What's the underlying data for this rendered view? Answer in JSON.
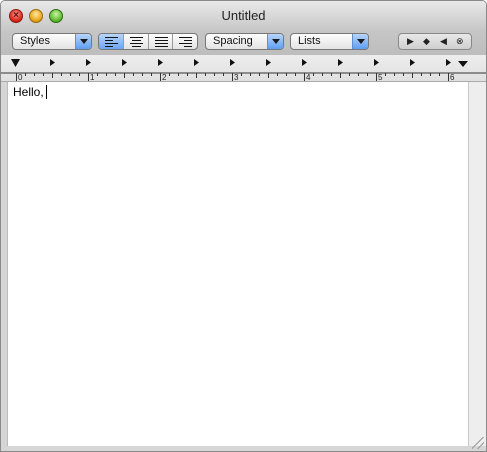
{
  "window": {
    "title": "Untitled"
  },
  "toolbar": {
    "styles_label": "Styles",
    "spacing_label": "Spacing",
    "lists_label": "Lists",
    "alignment": {
      "options": [
        "align-left",
        "align-center",
        "justify",
        "align-right"
      ],
      "selected": "align-left"
    },
    "nav": [
      "▶",
      "◆",
      "◀",
      "⊗"
    ]
  },
  "ruler": {
    "numbers": [
      "0",
      "1",
      "2",
      "3",
      "4",
      "5",
      "6"
    ]
  },
  "document": {
    "text": "Hello,"
  },
  "colors": {
    "accent": "#6aa6f4",
    "close": "#d8271c",
    "minimize": "#e8a51b",
    "zoom": "#5dbb2c"
  }
}
